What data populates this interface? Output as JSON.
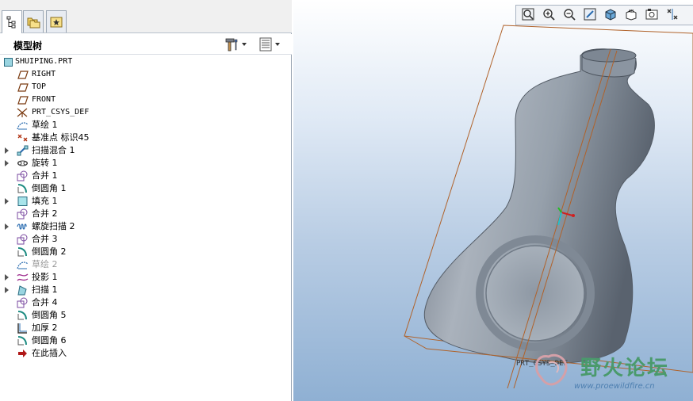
{
  "tabs": [
    {
      "name": "model-tree-tab",
      "icon": "tree-structure-icon",
      "active": true
    },
    {
      "name": "folder-browser-tab",
      "icon": "folders-icon",
      "active": false
    },
    {
      "name": "favorites-tab",
      "icon": "star-icon",
      "active": false
    }
  ],
  "tree_header": {
    "title": "模型树",
    "settings_icon": "hammer-wrench-icon",
    "columns_icon": "list-columns-icon"
  },
  "tree": {
    "items": [
      {
        "label": "SHUIPING.PRT",
        "icon": "part-icon",
        "expandable": false,
        "mono": true
      },
      {
        "label": "RIGHT",
        "icon": "datum-plane-icon",
        "expandable": false,
        "mono": true
      },
      {
        "label": "TOP",
        "icon": "datum-plane-icon",
        "expandable": false,
        "mono": true
      },
      {
        "label": "FRONT",
        "icon": "datum-plane-icon",
        "expandable": false,
        "mono": true
      },
      {
        "label": "PRT_CSYS_DEF",
        "icon": "csys-icon",
        "expandable": false,
        "mono": true
      },
      {
        "label": "草绘 1",
        "icon": "sketch-icon",
        "expandable": false
      },
      {
        "label": "基准点 标识45",
        "icon": "datum-point-icon",
        "expandable": false
      },
      {
        "label": "扫描混合 1",
        "icon": "swept-blend-icon",
        "expandable": true
      },
      {
        "label": "旋转 1",
        "icon": "revolve-icon",
        "expandable": true
      },
      {
        "label": "合并 1",
        "icon": "merge-icon",
        "expandable": false
      },
      {
        "label": "倒圆角 1",
        "icon": "round-icon",
        "expandable": false
      },
      {
        "label": "填充 1",
        "icon": "fill-icon",
        "expandable": true
      },
      {
        "label": "合并 2",
        "icon": "merge-icon",
        "expandable": false
      },
      {
        "label": "螺旋扫描 2",
        "icon": "helical-sweep-icon",
        "expandable": true
      },
      {
        "label": "合并 3",
        "icon": "merge-icon",
        "expandable": false
      },
      {
        "label": "倒圆角 2",
        "icon": "round-icon",
        "expandable": false
      },
      {
        "label": "草绘 2",
        "icon": "sketch-icon",
        "expandable": false,
        "dim": true
      },
      {
        "label": "投影 1",
        "icon": "project-icon",
        "expandable": true
      },
      {
        "label": "扫描 1",
        "icon": "sweep-icon",
        "expandable": true
      },
      {
        "label": "合并 4",
        "icon": "merge-icon",
        "expandable": false
      },
      {
        "label": "倒圆角 5",
        "icon": "round-icon",
        "expandable": false
      },
      {
        "label": "加厚 2",
        "icon": "thicken-icon",
        "expandable": false
      },
      {
        "label": "倒圆角 6",
        "icon": "round-icon",
        "expandable": false
      },
      {
        "label": "在此插入",
        "icon": "insert-here-arrow-icon",
        "expandable": false
      }
    ]
  },
  "toolbar": {
    "buttons": [
      {
        "name": "refit-button",
        "icon": "zoom-fit-icon"
      },
      {
        "name": "zoom-in-button",
        "icon": "zoom-in-icon"
      },
      {
        "name": "zoom-out-button",
        "icon": "zoom-out-icon"
      },
      {
        "name": "repaint-button",
        "icon": "repaint-icon"
      },
      {
        "name": "display-style-button",
        "icon": "shaded-cube-icon"
      },
      {
        "name": "saved-views-button",
        "icon": "saved-views-icon"
      },
      {
        "name": "view-manager-button",
        "icon": "view-manager-icon"
      },
      {
        "name": "datum-display-button",
        "icon": "datum-display-icon"
      }
    ]
  },
  "viewport": {
    "csys_label": "PRT_CSYS_DEF",
    "watermark_text": "野火论坛",
    "watermark_url": "www.proewildfire.cn"
  },
  "colors": {
    "model_gray": "#8e98a4",
    "datum_orange": "#b0622a",
    "expander": "#555555",
    "insert_arrow": "#b01818"
  }
}
